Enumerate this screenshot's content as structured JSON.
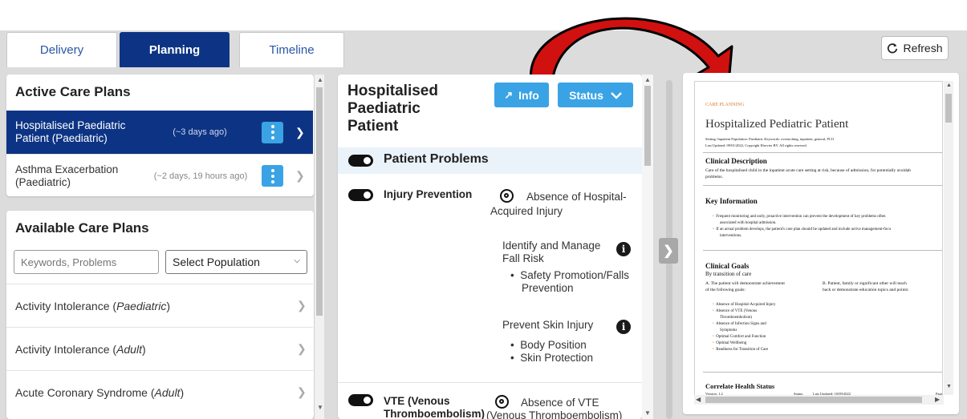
{
  "tabs": [
    {
      "label": "Delivery"
    },
    {
      "label": "Planning"
    },
    {
      "label": "Timeline"
    }
  ],
  "refresh_label": "Refresh",
  "active_plans": {
    "title": "Active Care Plans",
    "items": [
      {
        "name": "Hospitalised Paediatric Patient (Paediatric)",
        "age": "(~3 days ago)"
      },
      {
        "name": "Asthma Exacerbation (Paediatric)",
        "age": "(~2 days, 19 hours ago)"
      }
    ]
  },
  "available_plans": {
    "title": "Available Care Plans",
    "search_placeholder": "Keywords, Problems",
    "population_select": "Select Population",
    "items": [
      {
        "name": "Activity Intolerance (",
        "pop": "Paediatric",
        "end": ")"
      },
      {
        "name": "Activity Intolerance (",
        "pop": "Adult",
        "end": ")"
      },
      {
        "name": "Acute Coronary Syndrome (",
        "pop": "Adult",
        "end": ")"
      }
    ]
  },
  "plan_detail": {
    "title_line1": "Hospitalised",
    "title_line2": "Paediatric",
    "title_line3": "Patient",
    "info_label": "Info",
    "status_label": "Status",
    "section_title": "Patient Problems",
    "problems": [
      {
        "name": "Injury Prevention",
        "goal_line1": "Absence of Hospital-",
        "goal_line2": "Acquired Injury",
        "interventions": [
          {
            "title_line1": "Identify and Manage",
            "title_line2": "Fall Risk",
            "bullets": [
              "Safety Promotion/Falls",
              "Prevention"
            ]
          },
          {
            "title_line1": "Prevent Skin Injury",
            "bullets": [
              "Body Position",
              "Skin Protection"
            ]
          }
        ]
      },
      {
        "name_line1": "VTE (Venous",
        "name_line2": "Thromboembolism)",
        "goal_line1": "Absence of VTE",
        "goal_line2": "(Venous Thromboembolism)"
      }
    ]
  },
  "document": {
    "category": "CARE PLANNING",
    "title": "Hospitalized Pediatric Patient",
    "meta_line": "Setting: Inpatient    Population: Paediatric    Keywords: overarching, inpatient, general, PCO",
    "updated_line": "Last Updated: 09/01/2022, Copyright Elsevier BV. All rights reserved.",
    "clinical_description_heading": "Clinical Description",
    "clinical_description_text1": "Care of the hospitalised child in the inpatient acute care setting at risk, because of admission, for potentially avoidab",
    "clinical_description_text2": "problems.",
    "key_info_heading": "Key Information",
    "key_info_bullets": [
      "Frequent monitoring and early, proactive intervention can prevent the development of key problems often",
      "associated with hospital admission.",
      "If an actual problem develops, the patient's care plan should be updated and include active management-focu",
      "interventions."
    ],
    "clinical_goals_heading": "Clinical Goals",
    "clinical_goals_sub": "By transition of care",
    "goals_a_intro1": "A. The patient will demonstrate achievement",
    "goals_a_intro2": "of the following goals:",
    "goals_b_intro1": "B. Patient, family or significant other will teach",
    "goals_b_intro2": "back or demonstrate education topics and points:",
    "goals_a_items": [
      "Absence of Hospital-Acquired Injury",
      "Absence of VTE (Venous",
      "Thromboembolism)",
      "Absence of Infection Signs and",
      "Symptoms",
      "Optimal Comfort and Function",
      "Optimal Wellbeing",
      "Readiness for Transition of Care"
    ],
    "correlate_heading": "Correlate Health Status",
    "footer_version": "Version: 1.2",
    "footer_status": "Status:",
    "footer_updated": "Last Updated: 10/09/2022",
    "footer_page": "Page"
  },
  "colors": {
    "active_blue": "#0d3484",
    "accent_blue": "#3aa3e5",
    "arrow_red": "#d11010"
  }
}
